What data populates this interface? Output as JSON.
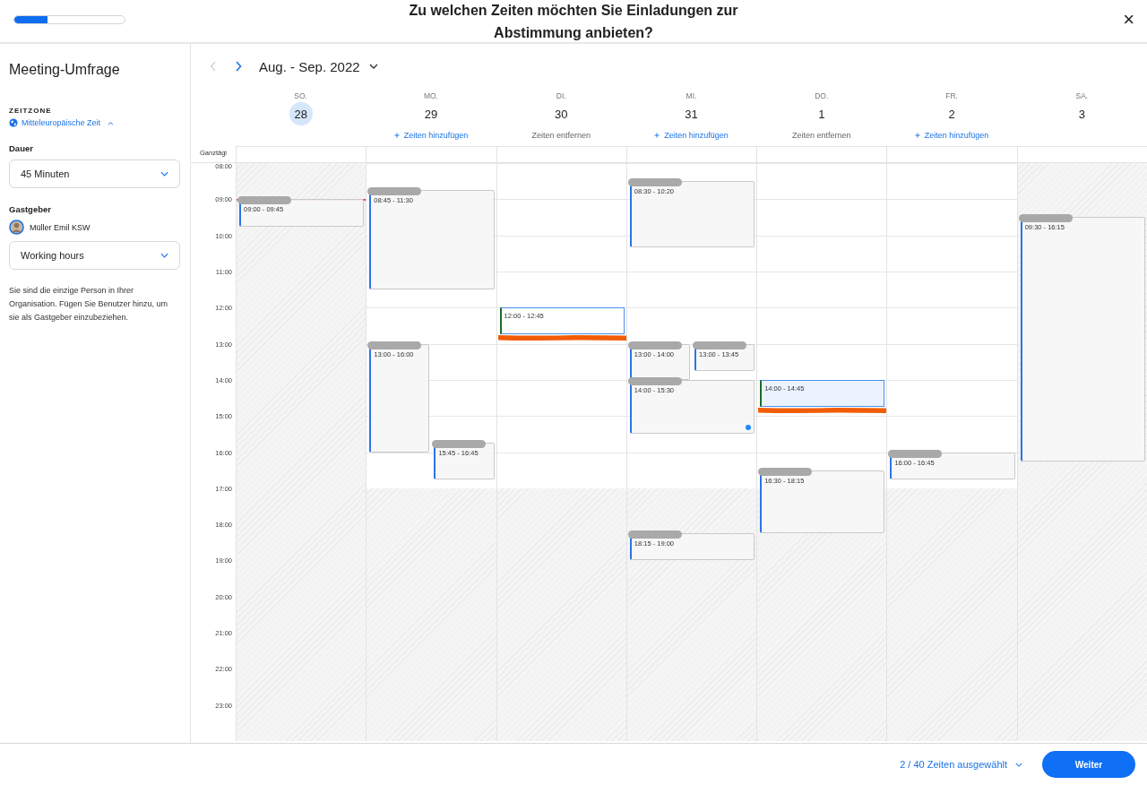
{
  "header": {
    "progress": {
      "level": 0.3
    },
    "title": "Zu welchen Zeiten möchten Sie Einladungen zur Abstimmung anbieten?",
    "close": "×"
  },
  "sidebar": {
    "title": "Meeting-Umfrage",
    "timezone_label": "ZEITZONE",
    "timezone": "Mitteleuropäische Zeit",
    "duration_label": "Dauer",
    "duration": "45 Minuten",
    "host_label": "Gastgeber",
    "host": "Müller Emil KSW",
    "hours": "Working hours",
    "note": "Sie sind die einzige Person in Ihrer Organisation. Fügen Sie Benutzer hinzu, um sie als Gastgeber einzubeziehen."
  },
  "calendar": {
    "range": "Aug. - Sep. 2022",
    "allday_label": "Ganztägi",
    "hours": [
      "08:00",
      "09:00",
      "10:00",
      "11:00",
      "12:00",
      "13:00",
      "14:00",
      "15:00",
      "16:00",
      "17:00",
      "18:00",
      "19:00",
      "20:00",
      "21:00",
      "22:00",
      "23:00"
    ],
    "days": [
      {
        "weekday": "SO.",
        "date": "28",
        "selected": true,
        "workday": false,
        "now_line": true,
        "events": [
          {
            "kind": "busy",
            "time": "09:00 - 09:45"
          }
        ]
      },
      {
        "weekday": "MO.",
        "date": "29",
        "selected": false,
        "workday": true,
        "now_line": false,
        "action": {
          "kind": "add",
          "label": "Zeiten hinzufügen"
        },
        "events": [
          {
            "kind": "busy",
            "time": "08:45 - 11:30"
          },
          {
            "kind": "busy",
            "time": "13:00 - 16:00"
          },
          {
            "kind": "busy",
            "time": "15:45 - 16:45"
          }
        ]
      },
      {
        "weekday": "DI.",
        "date": "30",
        "selected": false,
        "workday": true,
        "now_line": false,
        "action": {
          "kind": "remove",
          "label": "Zeiten entfernen"
        },
        "events": [
          {
            "kind": "proposed",
            "time": "12:00 - 12:45",
            "tinted": false
          }
        ]
      },
      {
        "weekday": "MI.",
        "date": "31",
        "selected": false,
        "workday": true,
        "now_line": false,
        "action": {
          "kind": "add",
          "label": "Zeiten hinzufügen"
        },
        "events": [
          {
            "kind": "busy",
            "time": "08:30 - 10:20"
          },
          {
            "kind": "busy",
            "time": "13:00 - 14:00"
          },
          {
            "kind": "busy",
            "time": "13:00 - 13:45"
          },
          {
            "kind": "busy",
            "time": "14:00 - 15:30",
            "dot": true
          },
          {
            "kind": "busy",
            "time": "18:15 - 19:00"
          }
        ]
      },
      {
        "weekday": "DO.",
        "date": "1",
        "selected": false,
        "workday": true,
        "now_line": false,
        "action": {
          "kind": "remove",
          "label": "Zeiten entfernen"
        },
        "events": [
          {
            "kind": "proposed",
            "time": "14:00 - 14:45",
            "tinted": true
          },
          {
            "kind": "busy",
            "time": "16:30 - 18:15"
          }
        ]
      },
      {
        "weekday": "FR.",
        "date": "2",
        "selected": false,
        "workday": true,
        "now_line": false,
        "action": {
          "kind": "add",
          "label": "Zeiten hinzufügen"
        },
        "events": [
          {
            "kind": "busy",
            "time": "16:00 - 16:45"
          }
        ]
      },
      {
        "weekday": "SA.",
        "date": "3",
        "selected": false,
        "workday": false,
        "now_line": false,
        "events": [
          {
            "kind": "busy",
            "time": "09:30 - 16:15"
          }
        ]
      }
    ]
  },
  "footer": {
    "selection": "2 / 40 Zeiten ausgewählt",
    "next": "Weiter"
  }
}
